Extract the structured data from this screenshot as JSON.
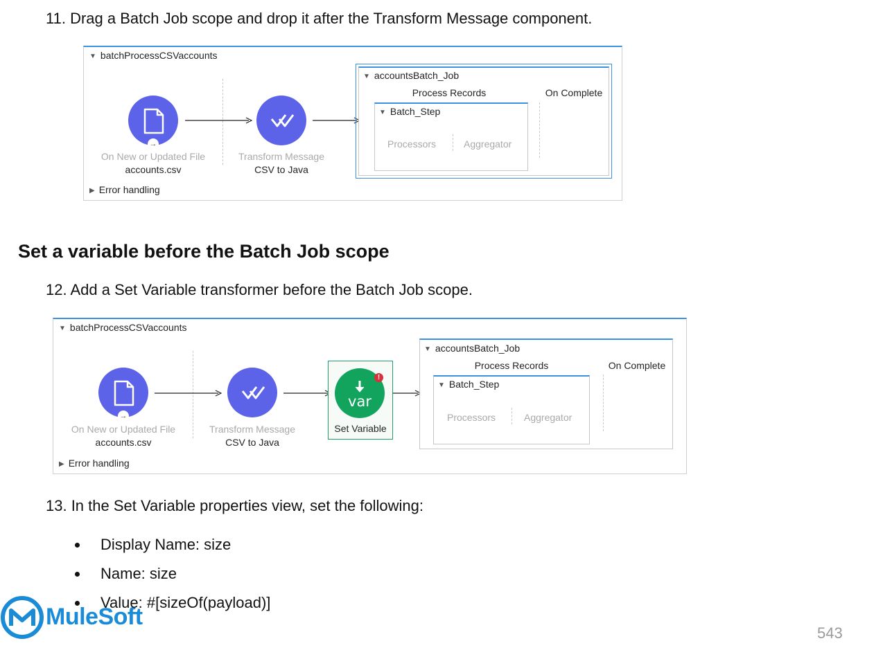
{
  "step11": "11. Drag a Batch Job scope and drop it after the Transform Message component.",
  "heading": "Set a variable before the Batch Job scope",
  "step12": "12. Add a Set Variable transformer before the Batch Job scope.",
  "step13": "13. In the Set Variable properties view, set the following:",
  "bullets": [
    "Display Name: size",
    "Name: size",
    "Value: #[sizeOf(payload)]"
  ],
  "diagram1": {
    "flow_name": "batchProcessCSVaccounts",
    "source_label": "On New or Updated File",
    "source_sub": "accounts.csv",
    "transform_label": "Transform Message",
    "transform_sub": "CSV to Java",
    "batch_job": "accountsBatch_Job",
    "process_records": "Process Records",
    "on_complete": "On Complete",
    "batch_step": "Batch_Step",
    "processors": "Processors",
    "aggregator": "Aggregator",
    "error_handling": "Error handling"
  },
  "diagram2": {
    "flow_name": "batchProcessCSVaccounts",
    "source_label": "On New or Updated File",
    "source_sub": "accounts.csv",
    "transform_label": "Transform Message",
    "transform_sub": "CSV to Java",
    "setvar_icon_text": "var",
    "setvar_label": "Set Variable",
    "batch_job": "accountsBatch_Job",
    "process_records": "Process Records",
    "on_complete": "On Complete",
    "batch_step": "Batch_Step",
    "processors": "Processors",
    "aggregator": "Aggregator",
    "error_handling": "Error handling"
  },
  "logo_text": "MuleSoft",
  "page_number": "543",
  "colors": {
    "flow_blue": "#5c63e8",
    "accent_blue": "#3d8fe0",
    "setvar_green": "#12a35c",
    "logo_blue": "#1a8bd6"
  }
}
